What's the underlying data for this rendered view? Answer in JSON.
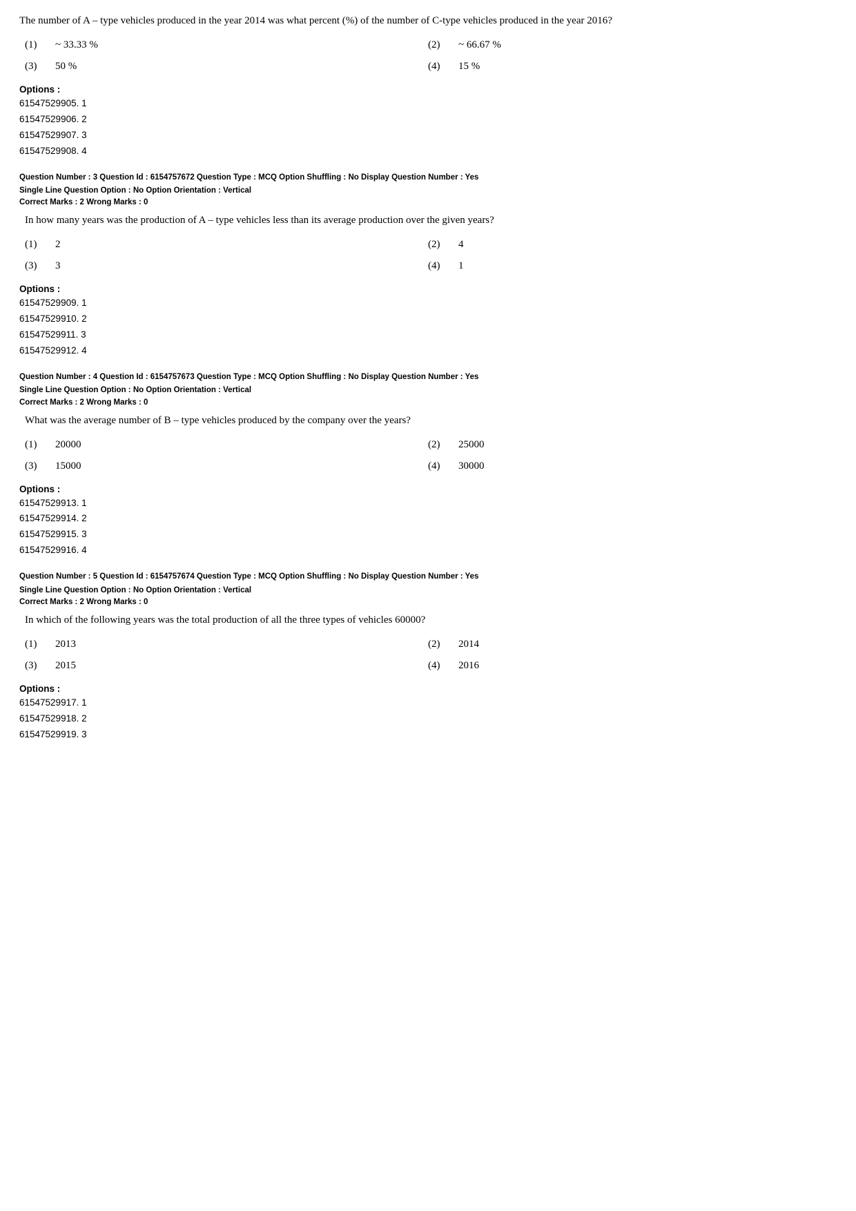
{
  "intro": {
    "text": "The number of A – type vehicles produced in the year 2014 was what percent (%) of the number of C-type vehicles produced in the year 2016?"
  },
  "q2": {
    "options": [
      {
        "num": "(1)",
        "val": "~ 33.33 %"
      },
      {
        "num": "(2)",
        "val": "~ 66.67 %"
      },
      {
        "num": "(3)",
        "val": "50 %"
      },
      {
        "num": "(4)",
        "val": "15 %"
      }
    ],
    "options_label": "Options :",
    "options_list": [
      "61547529905. 1",
      "61547529906. 2",
      "61547529907. 3",
      "61547529908. 4"
    ]
  },
  "q3": {
    "meta_line1": "Question Number : 3  Question Id : 6154757672  Question Type : MCQ  Option Shuffling : No  Display Question Number : Yes",
    "meta_line2": "Single Line Question Option : No  Option Orientation : Vertical",
    "correct_marks": "Correct Marks : 2  Wrong Marks : 0",
    "text": "In how many years was the production of A – type vehicles less than its average production over the given years?",
    "options": [
      {
        "num": "(1)",
        "val": "2"
      },
      {
        "num": "(2)",
        "val": "4"
      },
      {
        "num": "(3)",
        "val": "3"
      },
      {
        "num": "(4)",
        "val": "1"
      }
    ],
    "options_label": "Options :",
    "options_list": [
      "61547529909. 1",
      "61547529910. 2",
      "61547529911. 3",
      "61547529912. 4"
    ]
  },
  "q4": {
    "meta_line1": "Question Number : 4  Question Id : 6154757673  Question Type : MCQ  Option Shuffling : No  Display Question Number : Yes",
    "meta_line2": "Single Line Question Option : No  Option Orientation : Vertical",
    "correct_marks": "Correct Marks : 2  Wrong Marks : 0",
    "text": "What was the average number of B – type vehicles produced by the company over the years?",
    "options": [
      {
        "num": "(1)",
        "val": "20000"
      },
      {
        "num": "(2)",
        "val": "25000"
      },
      {
        "num": "(3)",
        "val": "15000"
      },
      {
        "num": "(4)",
        "val": "30000"
      }
    ],
    "options_label": "Options :",
    "options_list": [
      "61547529913. 1",
      "61547529914. 2",
      "61547529915. 3",
      "61547529916. 4"
    ]
  },
  "q5": {
    "meta_line1": "Question Number : 5  Question Id : 6154757674  Question Type : MCQ  Option Shuffling : No  Display Question Number : Yes",
    "meta_line2": "Single Line Question Option : No  Option Orientation : Vertical",
    "correct_marks": "Correct Marks : 2  Wrong Marks : 0",
    "text": "In which of the following years was the total production of all the three types of vehicles 60000?",
    "options": [
      {
        "num": "(1)",
        "val": "2013"
      },
      {
        "num": "(2)",
        "val": "2014"
      },
      {
        "num": "(3)",
        "val": "2015"
      },
      {
        "num": "(4)",
        "val": "2016"
      }
    ],
    "options_label": "Options :",
    "options_list": [
      "61547529917. 1",
      "61547529918. 2",
      "61547529919. 3"
    ]
  }
}
